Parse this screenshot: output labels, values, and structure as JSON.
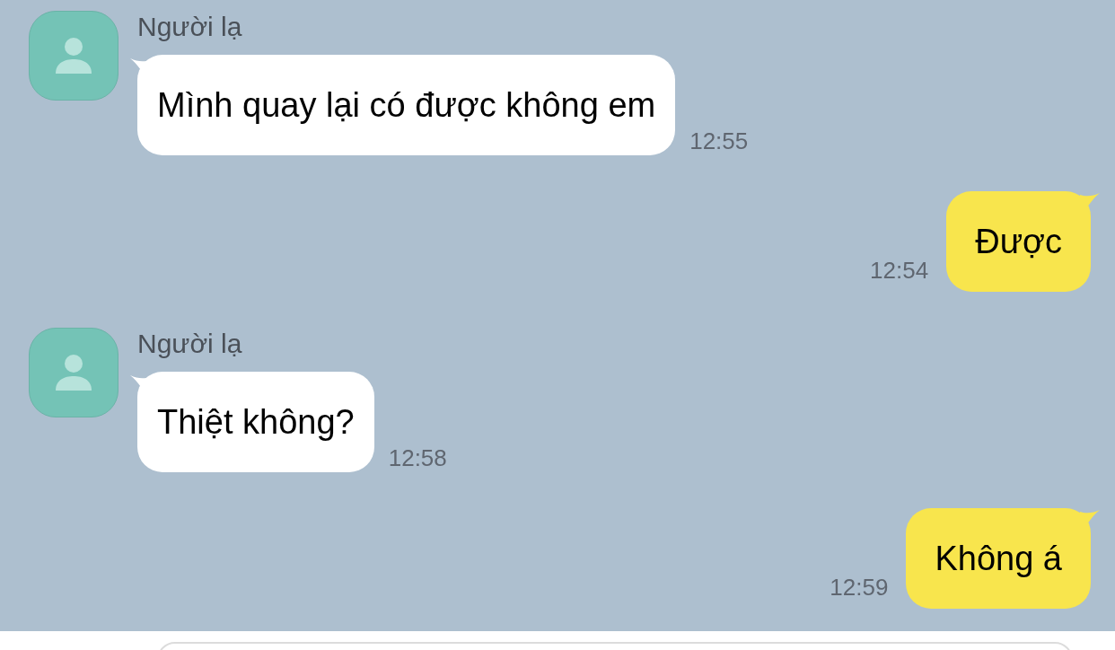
{
  "messages": [
    {
      "kind": "incoming",
      "sender": "Người lạ",
      "text": "Mình quay lại có được không em",
      "time": "12:55"
    },
    {
      "kind": "outgoing",
      "text": "Được",
      "time": "12:54"
    },
    {
      "kind": "incoming",
      "sender": "Người lạ",
      "text": "Thiệt không?",
      "time": "12:58"
    },
    {
      "kind": "outgoing",
      "text": "Không á",
      "time": "12:59"
    }
  ]
}
